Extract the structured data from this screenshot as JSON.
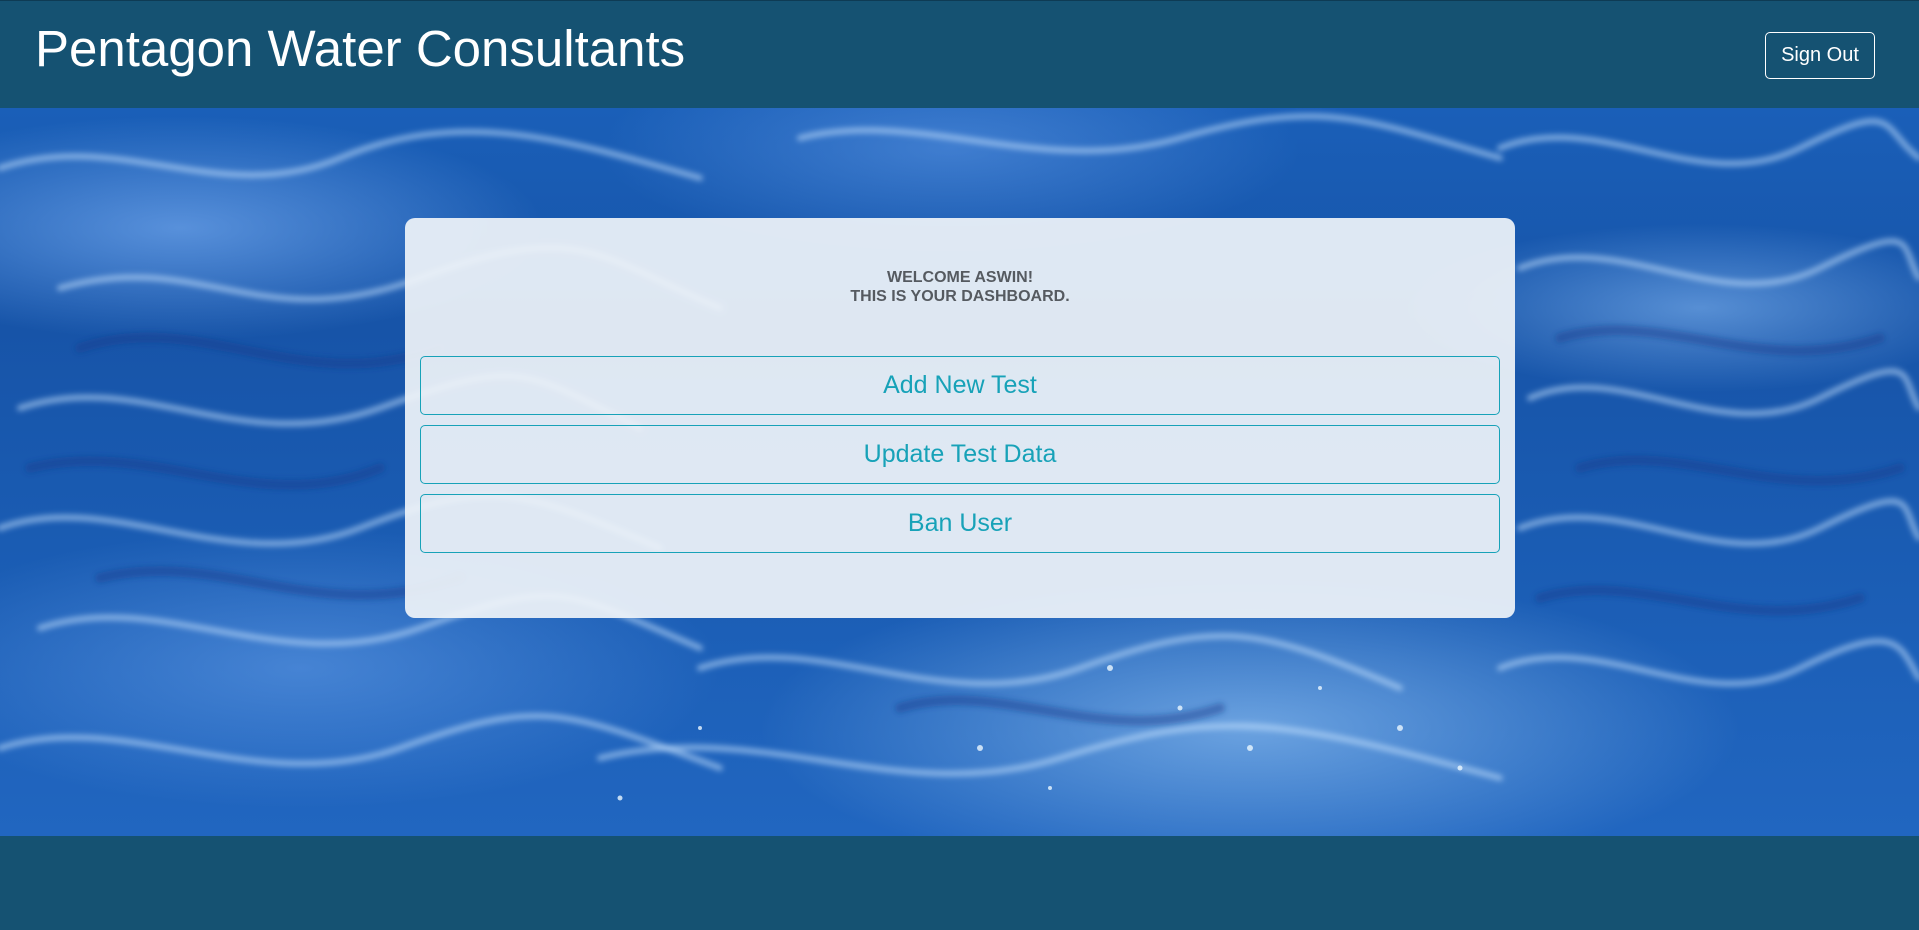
{
  "header": {
    "brand": "Pentagon Water Consultants",
    "signout_label": "Sign Out"
  },
  "dashboard": {
    "welcome_line1": "WELCOME ASWIN!",
    "welcome_line2": "THIS IS YOUR DASHBOARD.",
    "actions": [
      {
        "label": "Add New Test"
      },
      {
        "label": "Update Test Data"
      },
      {
        "label": "Ban User"
      }
    ]
  },
  "colors": {
    "navbar": "#155272",
    "accent": "#17a2b8",
    "card": "#f0f4f8"
  }
}
